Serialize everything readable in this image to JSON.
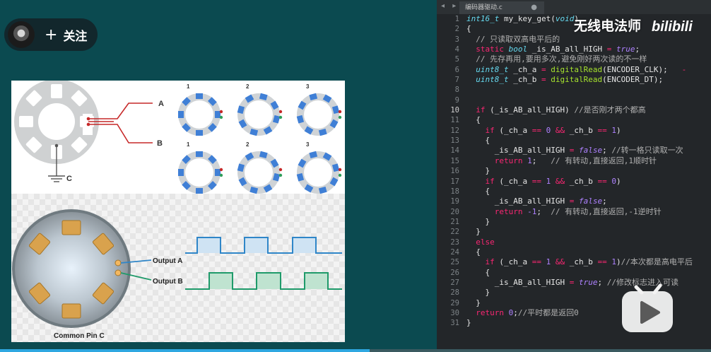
{
  "uploader": {
    "follow_label": "关注",
    "plus": "+"
  },
  "slide": {
    "labels": {
      "a": "A",
      "b": "B",
      "c": "C"
    },
    "steps_top": [
      "1",
      "2",
      "3"
    ],
    "steps_bottom": [
      "1",
      "2",
      "3"
    ],
    "output_a": "Output A",
    "output_b": "Output B",
    "common_pin": "Common Pin C",
    "colors": {
      "wave_a": "#2f86c8",
      "wave_b": "#1f9a6a",
      "wire": "#c62828",
      "ring_blue": "#3f7fd6"
    }
  },
  "editor": {
    "tab_nav": "◂ ▸",
    "tab_title": "编码器驱动.c",
    "tab_dot": "●",
    "active_line": 10,
    "lines": [
      [
        [
          "int16_t",
          "t-type"
        ],
        [
          " my_key_get(",
          ""
        ],
        [
          "void",
          "t-type"
        ],
        [
          ")",
          ""
        ]
      ],
      [
        [
          "{",
          ""
        ]
      ],
      [
        [
          "  // 只读取双高电平后的",
          "t-cm"
        ]
      ],
      [
        [
          "  ",
          ""
        ],
        [
          "static",
          "t-kw"
        ],
        [
          " ",
          ""
        ],
        [
          "bool",
          "t-type"
        ],
        [
          " _is_AB_all_HIGH ",
          ""
        ],
        [
          "=",
          "t-op"
        ],
        [
          " ",
          ""
        ],
        [
          "true",
          "t-bool"
        ],
        [
          ";",
          ""
        ]
      ],
      [
        [
          "  // 先存再用,要用多次,避免刚好两次读的不一样",
          "t-cm"
        ]
      ],
      [
        [
          "  ",
          ""
        ],
        [
          "uint8_t",
          "t-type"
        ],
        [
          " _ch_a ",
          ""
        ],
        [
          "=",
          "t-op"
        ],
        [
          " ",
          ""
        ],
        [
          "digitalRead",
          "t-fn"
        ],
        [
          "(ENCODER_CLK);   ",
          ""
        ],
        [
          "-",
          "t-op"
        ]
      ],
      [
        [
          "  ",
          ""
        ],
        [
          "uint8_t",
          "t-type"
        ],
        [
          " _ch_b ",
          ""
        ],
        [
          "=",
          "t-op"
        ],
        [
          " ",
          ""
        ],
        [
          "digitalRead",
          "t-fn"
        ],
        [
          "(ENCODER_DT);",
          ""
        ]
      ],
      [
        [
          "",
          ""
        ]
      ],
      [
        [
          "",
          ""
        ]
      ],
      [
        [
          "  ",
          ""
        ],
        [
          "if",
          "t-kw"
        ],
        [
          " (_is_AB_all_HIGH) ",
          ""
        ],
        [
          "//是否刚才两个都高",
          "t-cm"
        ]
      ],
      [
        [
          "  {",
          ""
        ]
      ],
      [
        [
          "    ",
          ""
        ],
        [
          "if",
          "t-kw"
        ],
        [
          " (_ch_a ",
          ""
        ],
        [
          "==",
          "t-op"
        ],
        [
          " ",
          ""
        ],
        [
          "0",
          "t-num"
        ],
        [
          " ",
          ""
        ],
        [
          "&&",
          "t-op"
        ],
        [
          " _ch_b ",
          ""
        ],
        [
          "==",
          "t-op"
        ],
        [
          " ",
          ""
        ],
        [
          "1",
          "t-num"
        ],
        [
          ")",
          ""
        ]
      ],
      [
        [
          "    {",
          ""
        ]
      ],
      [
        [
          "      _is_AB_all_HIGH ",
          ""
        ],
        [
          "=",
          "t-op"
        ],
        [
          " ",
          ""
        ],
        [
          "false",
          "t-bool"
        ],
        [
          "; ",
          ""
        ],
        [
          "//转一格只读取一次",
          "t-cm"
        ]
      ],
      [
        [
          "      ",
          ""
        ],
        [
          "return",
          "t-kw"
        ],
        [
          " ",
          ""
        ],
        [
          "1",
          "t-num"
        ],
        [
          ";   ",
          ""
        ],
        [
          "// 有转动,直接返回,1顺时针",
          "t-cm"
        ]
      ],
      [
        [
          "    }",
          ""
        ]
      ],
      [
        [
          "    ",
          ""
        ],
        [
          "if",
          "t-kw"
        ],
        [
          " (_ch_a ",
          ""
        ],
        [
          "==",
          "t-op"
        ],
        [
          " ",
          ""
        ],
        [
          "1",
          "t-num"
        ],
        [
          " ",
          ""
        ],
        [
          "&&",
          "t-op"
        ],
        [
          " _ch_b ",
          ""
        ],
        [
          "==",
          "t-op"
        ],
        [
          " ",
          ""
        ],
        [
          "0",
          "t-num"
        ],
        [
          ")",
          ""
        ]
      ],
      [
        [
          "    {",
          ""
        ]
      ],
      [
        [
          "      _is_AB_all_HIGH ",
          ""
        ],
        [
          "=",
          "t-op"
        ],
        [
          " ",
          ""
        ],
        [
          "false",
          "t-bool"
        ],
        [
          ";",
          ""
        ]
      ],
      [
        [
          "      ",
          ""
        ],
        [
          "return",
          "t-kw"
        ],
        [
          " ",
          ""
        ],
        [
          "-1",
          "t-num"
        ],
        [
          ";  ",
          ""
        ],
        [
          "// 有转动,直接返回,-1逆时针",
          "t-cm"
        ]
      ],
      [
        [
          "    }",
          ""
        ]
      ],
      [
        [
          "  }",
          ""
        ]
      ],
      [
        [
          "  ",
          ""
        ],
        [
          "else",
          "t-kw"
        ]
      ],
      [
        [
          "  {",
          ""
        ]
      ],
      [
        [
          "    ",
          ""
        ],
        [
          "if",
          "t-kw"
        ],
        [
          " (_ch_a ",
          ""
        ],
        [
          "==",
          "t-op"
        ],
        [
          " ",
          ""
        ],
        [
          "1",
          "t-num"
        ],
        [
          " ",
          ""
        ],
        [
          "&&",
          "t-op"
        ],
        [
          " _ch_b ",
          ""
        ],
        [
          "==",
          "t-op"
        ],
        [
          " ",
          ""
        ],
        [
          "1",
          "t-num"
        ],
        [
          ")",
          ""
        ],
        [
          "//本次都是高电平后",
          "t-cm"
        ]
      ],
      [
        [
          "    {",
          ""
        ]
      ],
      [
        [
          "      _is_AB_all_HIGH ",
          ""
        ],
        [
          "=",
          "t-op"
        ],
        [
          " ",
          ""
        ],
        [
          "true",
          "t-bool"
        ],
        [
          "; ",
          ""
        ],
        [
          "//修改标志进入可读",
          "t-cm"
        ]
      ],
      [
        [
          "    }",
          ""
        ]
      ],
      [
        [
          "  }",
          ""
        ]
      ],
      [
        [
          "  ",
          ""
        ],
        [
          "return",
          "t-kw"
        ],
        [
          " ",
          ""
        ],
        [
          "0",
          "t-num"
        ],
        [
          ";",
          ""
        ],
        [
          "//平时都是返回0",
          "t-cm"
        ]
      ],
      [
        [
          "}",
          ""
        ]
      ]
    ]
  },
  "watermark": {
    "channel": "无线电法师",
    "logo": "bilibili"
  },
  "player": {
    "progress": 0.52
  }
}
